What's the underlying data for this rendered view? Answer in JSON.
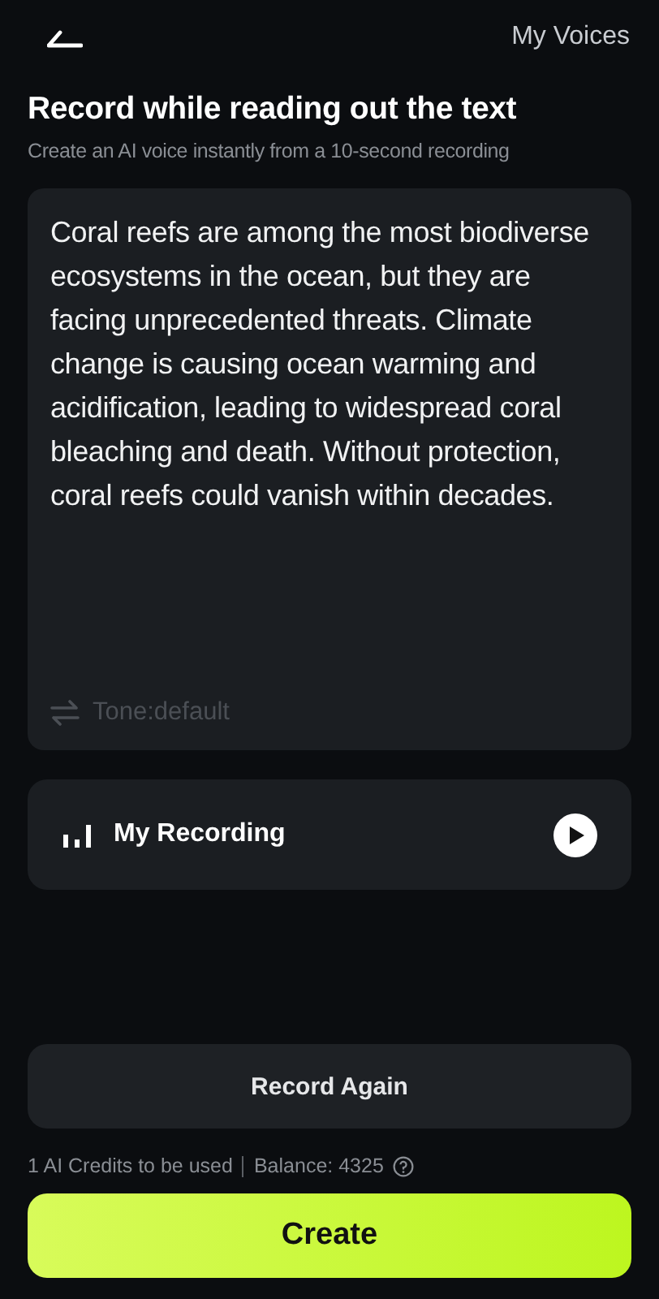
{
  "header": {
    "link": "My Voices"
  },
  "title": "Record while reading out the text",
  "subtitle": "Create an AI voice instantly from a 10-second recording",
  "script_text": "Coral reefs are among the most biodiverse ecosystems in the ocean, but they are facing unprecedented threats. Climate change is causing ocean warming and acidification, leading to widespread coral bleaching and death. Without protection, coral reefs could vanish within decades.",
  "tone": "Tone:default",
  "recording": {
    "label": "My Recording"
  },
  "record_again": "Record Again",
  "credits": {
    "usage": "1 AI Credits to be used",
    "balance": "Balance: 4325"
  },
  "create": "Create"
}
